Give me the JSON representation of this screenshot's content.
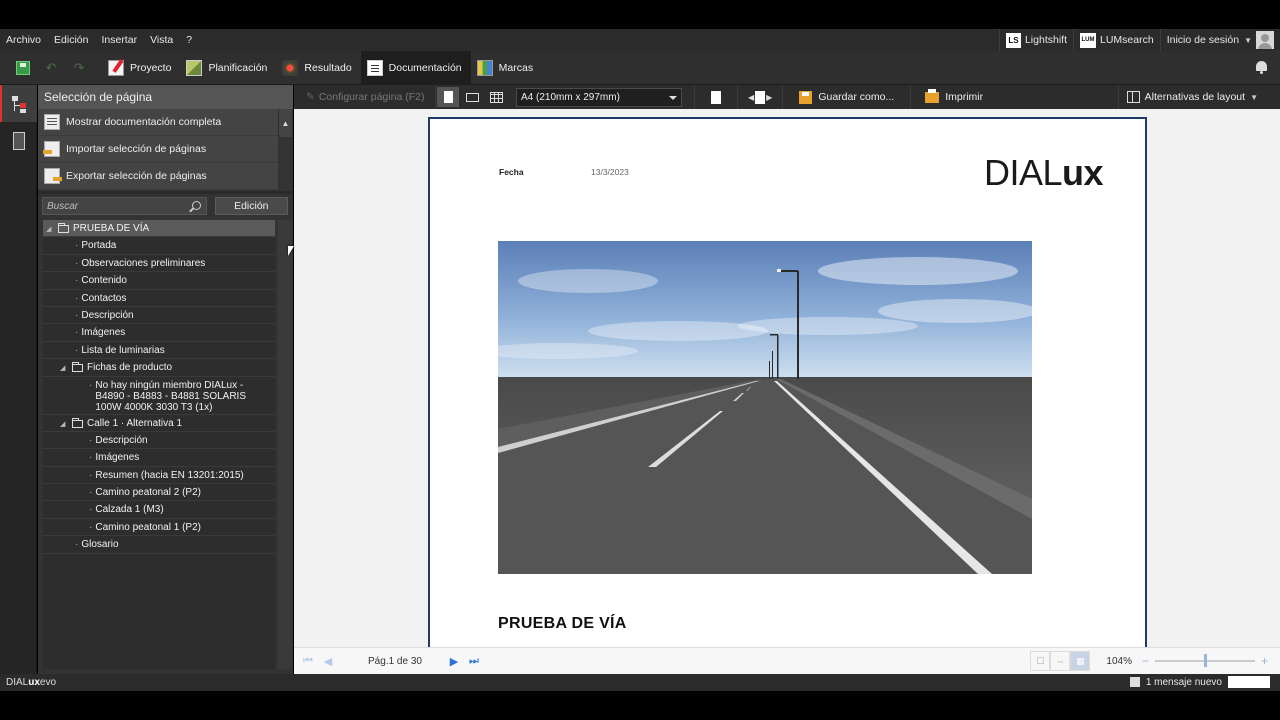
{
  "menubar": {
    "items": [
      "Archivo",
      "Edición",
      "Insertar",
      "Vista",
      "?"
    ],
    "lightshift": "Lightshift",
    "lightshift_badge": "LS",
    "lumsearch": "LUMsearch",
    "lumsearch_badge": "LUM",
    "login": "Inicio de sesión"
  },
  "ribbon": {
    "tabs": [
      "Proyecto",
      "Planificación",
      "Resultado",
      "Documentación",
      "Marcas"
    ],
    "active_tab": "Documentación"
  },
  "left_panel": {
    "title": "Selección de página",
    "actions": [
      "Mostrar documentación completa",
      "Importar selección de páginas",
      "Exportar selección de páginas"
    ],
    "search_placeholder": "Buscar",
    "edit_button": "Edición",
    "tree": {
      "root": "PRUEBA DE VÍA",
      "items": [
        "Portada",
        "Observaciones preliminares",
        "Contenido",
        "Contactos",
        "Descripción",
        "Imágenes",
        "Lista de luminarias"
      ],
      "product_folder": "Fichas de producto",
      "product_item": "No hay ningún miembro DIALux - B4890 - B4883 - B4881 SOLARIS 100W 4000K 3030 T3 (1x)",
      "street_folder": "Calle 1 · Alternativa 1",
      "street_items": [
        "Descripción",
        "Imágenes",
        "Resumen (hacia EN 13201:2015)",
        "Camino peatonal 2 (P2)",
        "Calzada 1 (M3)",
        "Camino peatonal 1 (P2)"
      ],
      "last": "Glosario"
    }
  },
  "doc_toolbar": {
    "configure": "Configurar página (F2)",
    "paper": "A4 (210mm x 297mm)",
    "save_as": "Guardar como...",
    "print": "Imprimir",
    "layout_alternatives": "Alternativas de layout"
  },
  "page": {
    "fecha_label": "Fecha",
    "fecha_value": "13/3/2023",
    "logo_light": "DIAL",
    "logo_bold": "ux",
    "heading": "PRUEBA DE VÍA"
  },
  "nav": {
    "page_indicator": "Pág.1 de 30",
    "zoom": "104%",
    "zoom_level": 0.5
  },
  "status": {
    "logo_light": "DIAL",
    "logo_bold": "ux",
    "logo_suffix": "evo",
    "message": "1 mensaje nuevo"
  },
  "colors": {
    "accent_blue": "#2a6fdb",
    "page_border": "#1e3a68",
    "orange": "#e8a22b"
  }
}
